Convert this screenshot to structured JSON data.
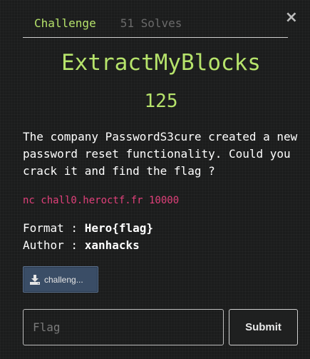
{
  "modal": {
    "close_glyph": "×",
    "tabs": [
      {
        "label": "Challenge"
      },
      {
        "label": "51 Solves"
      }
    ],
    "title": "ExtractMyBlocks",
    "points": "125",
    "description": "The company PasswordS3cure created a new password reset functionality. Could you crack it and find the flag ?",
    "connection": "nc chall0.heroctf.fr 10000",
    "format_label": "Format : ",
    "format_value": "Hero{flag}",
    "author_label": "Author : ",
    "author_value": "xanhacks",
    "file_button": {
      "label": "challeng...",
      "icon": "download-icon"
    },
    "flag_input": {
      "placeholder": "Flag",
      "value": ""
    },
    "submit_label": "Submit"
  },
  "colors": {
    "accent": "#b6e36b",
    "connection": "#e0407a",
    "file_button_bg": "#3a4d66",
    "background": "#1b1c1c"
  }
}
